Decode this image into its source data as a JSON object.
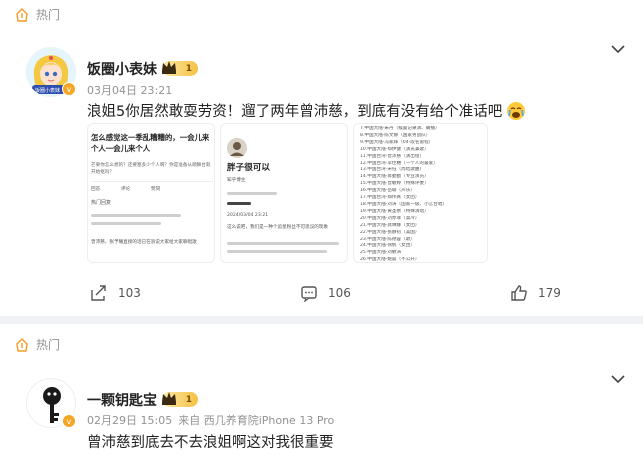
{
  "post1": {
    "hot_label": "热门",
    "username": "饭圈小表妹",
    "level": "1",
    "timestamp": "03月04日 23:21",
    "text": "浪姐5你居然敢耍劳资！遛了两年曾沛慈，到底有没有给个准话吧",
    "avatar_caption": "饭圈小表妹",
    "thumbnails": {
      "thumb1": {
        "title": "怎么感觉这一季乱糟糟的，一会儿来个人一会儿来个人",
        "sub": "芒果你怎么想的？还要塞多少个人啊？你是准备从頭舞台就开始抠吗？",
        "tabs": [
          "回答",
          "评论",
          "赞同"
        ],
        "section": "热门回复",
        "reply": "曾沛慈，张予曦直接的话已在浪说大家给大家聊唱歌"
      },
      "thumb2": {
        "name": "胖子很可以",
        "subtitle": "知乎博主",
        "date": "2024/03/04 23:21",
        "body": "这么说吧，我们是一种个追星粉丝不可思议的现象"
      },
      "thumb3_lines": [
        "7.中国大陆-朱丹（候置记录演、确播）",
        "8.中国大陆-陈文静（国家男战队）",
        "9.中国大陆-冯家辉（04-段名雷程）",
        "10.中国大陆-郑伊健（演员兼歌）",
        "11.中国台湾-曾沛慈（演出组）",
        "12.中国台湾-李佳穗（一个人的最爱）",
        "13.中国台湾-宋钰（周结歌曲）",
        "14.中国大陆-蒋勤勤（专业演员）",
        "15.中国大陆-曾敏婷（特殊评委）",
        "16.中国大陆-岳瑜（声乐）",
        "17.中国台湾-郑伟真（女团）",
        "18.中国大陆-刘涛（国家一级、小言合唱）",
        "19.中国大陆-黄圣依（特殊演唱）",
        "20.中国大陆-刘亦菲（高冷）",
        "21.中国大陆-龚琳娜（女团）",
        "22.中国大陆-张静初（美国）",
        "23.中国大陆-陈德容（歌）",
        "24.中国大陆-徐帆（女团）",
        "25.中国大陆-刘敏涛",
        "26.中国大陆-姚晨（不公开）"
      ]
    },
    "actions": {
      "share_count": "103",
      "comment_count": "106",
      "like_count": "179"
    }
  },
  "post2": {
    "hot_label": "热门",
    "username": "一颗钥匙宝",
    "level": "1",
    "timestamp": "02月29日 15:05",
    "source": "来自 西几养育院iPhone 13 Pro",
    "text": "曾沛慈到底去不去浪姐啊这对我很重要"
  },
  "colors": {
    "accent": "#ff8200",
    "hot_icon": "#f59b22",
    "background": "#f0f1f4",
    "meta_text": "#939393"
  }
}
